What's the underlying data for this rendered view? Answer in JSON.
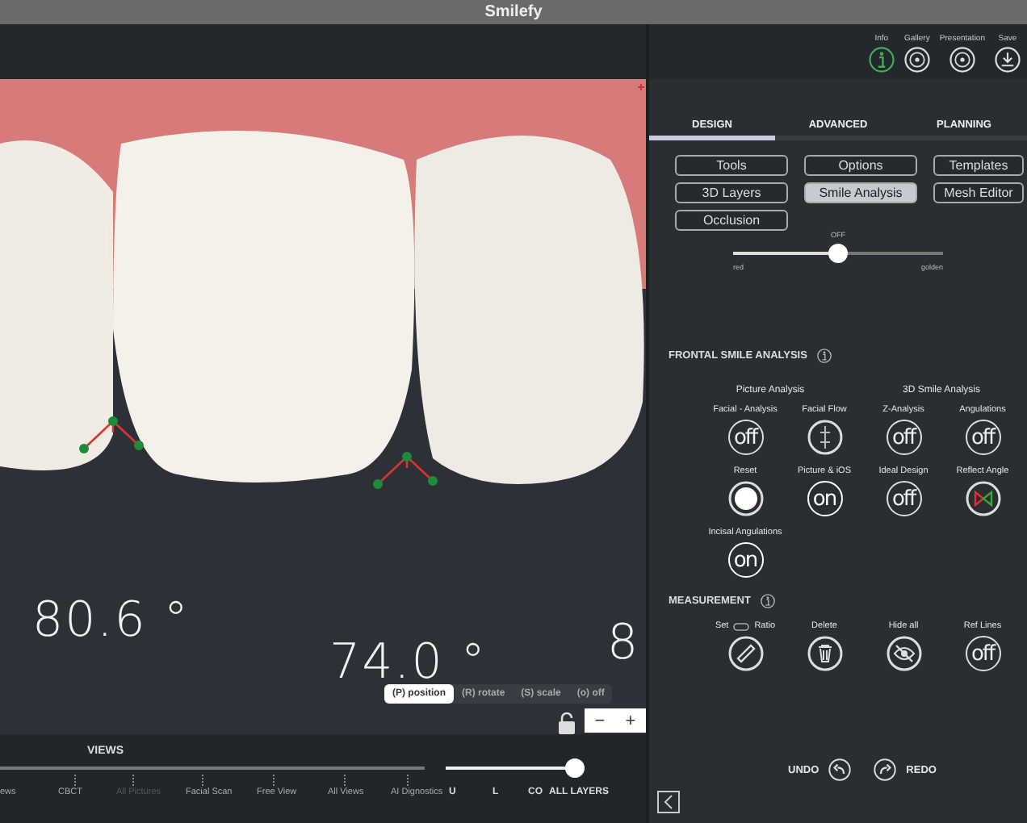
{
  "window": {
    "title": "Smilefy"
  },
  "toolbar": [
    {
      "label": "Info",
      "kind": "info"
    },
    {
      "label": "Gallery",
      "kind": "target"
    },
    {
      "label": "Presentation",
      "kind": "target"
    },
    {
      "label": "Save",
      "kind": "download"
    }
  ],
  "viewer": {
    "angles": [
      {
        "text": "80.6 °"
      },
      {
        "text": "74.0 °"
      },
      {
        "text": "8"
      }
    ],
    "modes": [
      {
        "label": "(P) position",
        "selected": true
      },
      {
        "label": "(R) rotate",
        "selected": false
      },
      {
        "label": "(S) scale",
        "selected": false
      },
      {
        "label": "(o) off",
        "selected": false
      }
    ],
    "zoom_buttons": [
      "−",
      "+"
    ]
  },
  "views": {
    "title": "VIEWS",
    "items": [
      {
        "label": "ews",
        "disabled": false
      },
      {
        "label": "CBCT",
        "disabled": false
      },
      {
        "label": "All Pictures",
        "disabled": true
      },
      {
        "label": "Facial Scan",
        "disabled": false
      },
      {
        "label": "Free View",
        "disabled": false
      },
      {
        "label": "All Views",
        "disabled": false
      },
      {
        "label": "AI Dignostics",
        "disabled": false
      }
    ],
    "layers": {
      "level": 1,
      "labels": [
        "U",
        "L",
        "CO",
        "ALL LAYERS"
      ]
    }
  },
  "tabs": [
    {
      "label": "DESIGN",
      "selected": true
    },
    {
      "label": "ADVANCED",
      "selected": false
    },
    {
      "label": "PLANNING",
      "selected": false
    }
  ],
  "tool_buttons": [
    {
      "label": "Tools",
      "selected": false
    },
    {
      "label": "Options",
      "selected": false
    },
    {
      "label": "Templates",
      "selected": false
    },
    {
      "label": "3D Layers",
      "selected": false
    },
    {
      "label": "Smile Analysis",
      "selected": true
    },
    {
      "label": "Mesh Editor",
      "selected": false
    },
    {
      "label": "Occlusion",
      "selected": false
    }
  ],
  "ratio_slider": {
    "label": "OFF",
    "level": 0.5,
    "min_label": "red",
    "max_label": "golden"
  },
  "frontal_smile_analysis": {
    "title": "FRONTAL SMILE ANALYSIS",
    "groups": [
      "Picture Analysis",
      "3D Smile Analysis"
    ],
    "controls": [
      {
        "label": "Facial - Analysis",
        "kind": "switch",
        "on": false,
        "text": "off"
      },
      {
        "label": "Facial Flow",
        "kind": "flow"
      },
      {
        "label": "Z-Analysis",
        "kind": "switch",
        "on": false,
        "text": "off"
      },
      {
        "label": "Angulations",
        "kind": "switch",
        "on": false,
        "text": "off"
      },
      {
        "label": "Reset",
        "kind": "radio",
        "selected": true
      },
      {
        "label": "Picture & iOS",
        "kind": "switch",
        "on": true,
        "text": "on"
      },
      {
        "label": "Ideal Design",
        "kind": "switch",
        "on": false,
        "text": "off"
      },
      {
        "label": "Reflect Angle",
        "kind": "reflect"
      },
      {
        "label": "Incisal Angulations",
        "kind": "switch",
        "on": true,
        "text": "on"
      }
    ]
  },
  "measurement": {
    "title": "MEASUREMENT",
    "controls": [
      {
        "label": "Set",
        "label2": "Ratio",
        "kind": "ruler"
      },
      {
        "label": "Delete",
        "kind": "trash"
      },
      {
        "label": "Hide all",
        "kind": "eye"
      },
      {
        "label": "Ref Lines",
        "kind": "switch",
        "on": false,
        "text": "off"
      }
    ]
  },
  "history": {
    "undo": "UNDO",
    "redo": "REDO"
  }
}
